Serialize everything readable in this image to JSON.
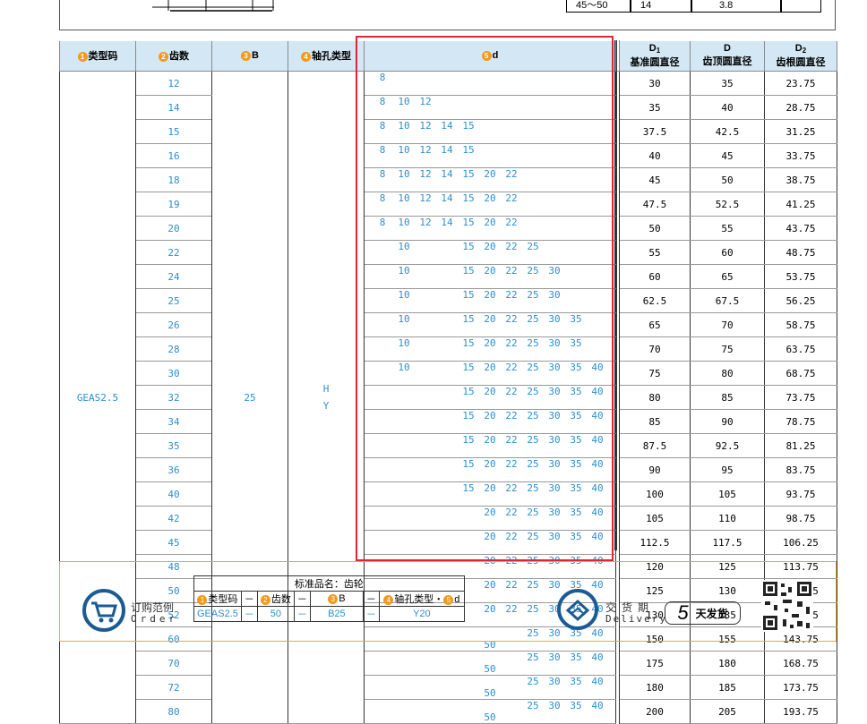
{
  "top_table_row": {
    "col1": "45～50",
    "col2": "14",
    "col3": "3.8",
    "col4": ""
  },
  "headers": {
    "type_code": {
      "num": "1",
      "label": "类型码"
    },
    "teeth": {
      "num": "2",
      "label": "齿数"
    },
    "b": {
      "num": "3",
      "label": "B"
    },
    "shaft": {
      "num": "4",
      "label": "轴孔类型"
    },
    "d": {
      "num": "5",
      "label": "d"
    },
    "d1_symbol": "D",
    "d1_sub": "1",
    "d1_label": "基准圆直径",
    "dd_symbol": "D",
    "dd_label": "齿顶圆直径",
    "d2_symbol": "D",
    "d2_sub": "2",
    "d2_label": "齿根圆直径"
  },
  "type_code_value": "GEAS2.5",
  "b_value": "25",
  "shaft_types": [
    "H",
    "Y"
  ],
  "d_columns": [
    "8",
    "10",
    "12",
    "14",
    "15",
    "20",
    "22",
    "25",
    "30",
    "35",
    "40",
    "50"
  ],
  "rows": [
    {
      "teeth": "12",
      "d": [
        "8"
      ],
      "D1": "30",
      "D": "35",
      "D2": "23.75"
    },
    {
      "teeth": "14",
      "d": [
        "8",
        "10",
        "12"
      ],
      "D1": "35",
      "D": "40",
      "D2": "28.75"
    },
    {
      "teeth": "15",
      "d": [
        "8",
        "10",
        "12",
        "14",
        "15"
      ],
      "D1": "37.5",
      "D": "42.5",
      "D2": "31.25"
    },
    {
      "teeth": "16",
      "d": [
        "8",
        "10",
        "12",
        "14",
        "15"
      ],
      "D1": "40",
      "D": "45",
      "D2": "33.75"
    },
    {
      "teeth": "18",
      "d": [
        "8",
        "10",
        "12",
        "14",
        "15",
        "20",
        "22"
      ],
      "D1": "45",
      "D": "50",
      "D2": "38.75"
    },
    {
      "teeth": "19",
      "d": [
        "8",
        "10",
        "12",
        "14",
        "15",
        "20",
        "22"
      ],
      "D1": "47.5",
      "D": "52.5",
      "D2": "41.25"
    },
    {
      "teeth": "20",
      "d": [
        "8",
        "10",
        "12",
        "14",
        "15",
        "20",
        "22"
      ],
      "D1": "50",
      "D": "55",
      "D2": "43.75"
    },
    {
      "teeth": "22",
      "d": [
        "10",
        "15",
        "20",
        "22",
        "25"
      ],
      "D1": "55",
      "D": "60",
      "D2": "48.75"
    },
    {
      "teeth": "24",
      "d": [
        "10",
        "15",
        "20",
        "22",
        "25",
        "30"
      ],
      "D1": "60",
      "D": "65",
      "D2": "53.75"
    },
    {
      "teeth": "25",
      "d": [
        "10",
        "15",
        "20",
        "22",
        "25",
        "30"
      ],
      "D1": "62.5",
      "D": "67.5",
      "D2": "56.25"
    },
    {
      "teeth": "26",
      "d": [
        "10",
        "15",
        "20",
        "22",
        "25",
        "30",
        "35"
      ],
      "D1": "65",
      "D": "70",
      "D2": "58.75"
    },
    {
      "teeth": "28",
      "d": [
        "10",
        "15",
        "20",
        "22",
        "25",
        "30",
        "35"
      ],
      "D1": "70",
      "D": "75",
      "D2": "63.75"
    },
    {
      "teeth": "30",
      "d": [
        "10",
        "15",
        "20",
        "22",
        "25",
        "30",
        "35",
        "40"
      ],
      "D1": "75",
      "D": "80",
      "D2": "68.75"
    },
    {
      "teeth": "32",
      "d": [
        "15",
        "20",
        "22",
        "25",
        "30",
        "35",
        "40"
      ],
      "D1": "80",
      "D": "85",
      "D2": "73.75"
    },
    {
      "teeth": "34",
      "d": [
        "15",
        "20",
        "22",
        "25",
        "30",
        "35",
        "40"
      ],
      "D1": "85",
      "D": "90",
      "D2": "78.75"
    },
    {
      "teeth": "35",
      "d": [
        "15",
        "20",
        "22",
        "25",
        "30",
        "35",
        "40"
      ],
      "D1": "87.5",
      "D": "92.5",
      "D2": "81.25"
    },
    {
      "teeth": "36",
      "d": [
        "15",
        "20",
        "22",
        "25",
        "30",
        "35",
        "40"
      ],
      "D1": "90",
      "D": "95",
      "D2": "83.75"
    },
    {
      "teeth": "40",
      "d": [
        "15",
        "20",
        "22",
        "25",
        "30",
        "35",
        "40"
      ],
      "D1": "100",
      "D": "105",
      "D2": "93.75"
    },
    {
      "teeth": "42",
      "d": [
        "20",
        "22",
        "25",
        "30",
        "35",
        "40"
      ],
      "D1": "105",
      "D": "110",
      "D2": "98.75"
    },
    {
      "teeth": "45",
      "d": [
        "20",
        "22",
        "25",
        "30",
        "35",
        "40"
      ],
      "D1": "112.5",
      "D": "117.5",
      "D2": "106.25"
    },
    {
      "teeth": "48",
      "d": [
        "20",
        "22",
        "25",
        "30",
        "35",
        "40"
      ],
      "D1": "120",
      "D": "125",
      "D2": "113.75"
    },
    {
      "teeth": "50",
      "d": [
        "20",
        "22",
        "25",
        "30",
        "35",
        "40"
      ],
      "D1": "125",
      "D": "130",
      "D2": "118.75"
    },
    {
      "teeth": "52",
      "d": [
        "20",
        "22",
        "25",
        "30",
        "35",
        "40"
      ],
      "D1": "130",
      "D": "135",
      "D2": "123.75"
    },
    {
      "teeth": "60",
      "d": [
        "25",
        "30",
        "35",
        "40",
        "50"
      ],
      "D1": "150",
      "D": "155",
      "D2": "143.75"
    },
    {
      "teeth": "70",
      "d": [
        "25",
        "30",
        "35",
        "40",
        "50"
      ],
      "D1": "175",
      "D": "180",
      "D2": "168.75"
    },
    {
      "teeth": "72",
      "d": [
        "25",
        "30",
        "35",
        "40",
        "50"
      ],
      "D1": "180",
      "D": "185",
      "D2": "173.75"
    },
    {
      "teeth": "80",
      "d": [
        "25",
        "30",
        "35",
        "40",
        "50"
      ],
      "D1": "200",
      "D": "205",
      "D2": "193.75"
    }
  ],
  "order": {
    "label_cn": "订购范例",
    "label_en": "Order",
    "example_title": "标准品名：齿轮",
    "h1": "类型码",
    "h2": "齿数",
    "h3": "B",
    "h4": "轴孔类型・",
    "h5": "d",
    "v1": "GEAS2.5",
    "v2": "50",
    "v3": "B25",
    "v4": "Y20",
    "dash": "－"
  },
  "delivery": {
    "label_cn": "交货期",
    "label_en": "Delivery",
    "days": "5",
    "unit": "天发货"
  },
  "colors": {
    "header_bg": "#d3e8f4",
    "accent_orange": "#f39a1e",
    "value_blue": "#2c8fd0",
    "highlight_red": "#e0262e",
    "icon_blue": "#1b5b93"
  }
}
